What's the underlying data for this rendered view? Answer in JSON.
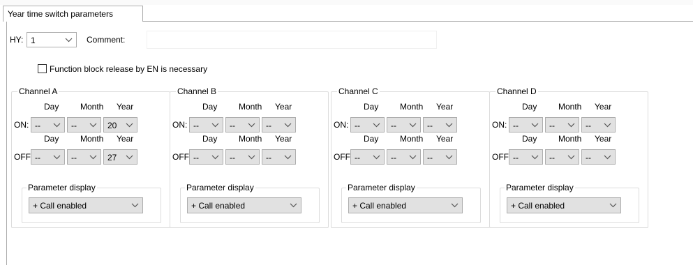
{
  "tab": {
    "label": "Year time switch parameters"
  },
  "hy": {
    "label": "HY:",
    "value": "1"
  },
  "comment": {
    "label": "Comment:",
    "value": ""
  },
  "release_checkbox": {
    "label": "Function block release by EN is necessary",
    "checked": false
  },
  "channels": [
    {
      "title": "Channel A",
      "on": {
        "label": "ON:",
        "headers": [
          "Day",
          "Month",
          "Year"
        ],
        "day": "--",
        "month": "--",
        "year": "20"
      },
      "off": {
        "label": "OFF:",
        "headers": [
          "Day",
          "Month",
          "Year"
        ],
        "day": "--",
        "month": "--",
        "year": "27"
      },
      "parameter_display": {
        "label": "Parameter display",
        "value": "+ Call enabled"
      }
    },
    {
      "title": "Channel B",
      "on": {
        "label": "ON:",
        "headers": [
          "Day",
          "Month",
          "Year"
        ],
        "day": "--",
        "month": "--",
        "year": "--"
      },
      "off": {
        "label": "OFF:",
        "headers": [
          "Day",
          "Month",
          "Year"
        ],
        "day": "--",
        "month": "--",
        "year": "--"
      },
      "parameter_display": {
        "label": "Parameter display",
        "value": "+ Call enabled"
      }
    },
    {
      "title": "Channel C",
      "on": {
        "label": "ON:",
        "headers": [
          "Day",
          "Month",
          "Year"
        ],
        "day": "--",
        "month": "--",
        "year": "--"
      },
      "off": {
        "label": "OFF:",
        "headers": [
          "Day",
          "Month",
          "Year"
        ],
        "day": "--",
        "month": "--",
        "year": "--"
      },
      "parameter_display": {
        "label": "Parameter display",
        "value": "+ Call enabled"
      }
    },
    {
      "title": "Channel D",
      "on": {
        "label": "ON:",
        "headers": [
          "Day",
          "Month",
          "Year"
        ],
        "day": "--",
        "month": "--",
        "year": "--"
      },
      "off": {
        "label": "OFF:",
        "headers": [
          "Day",
          "Month",
          "Year"
        ],
        "day": "--",
        "month": "--",
        "year": "--"
      },
      "parameter_display": {
        "label": "Parameter display",
        "value": "+ Call enabled"
      }
    }
  ],
  "colors": {
    "combo_background": "#e1e1e1",
    "combo_border": "#adadad",
    "group_border": "#dcdcdc",
    "tab_border": "#a9a9a9"
  },
  "icons": {
    "dropdown": "chevron-down-icon"
  }
}
